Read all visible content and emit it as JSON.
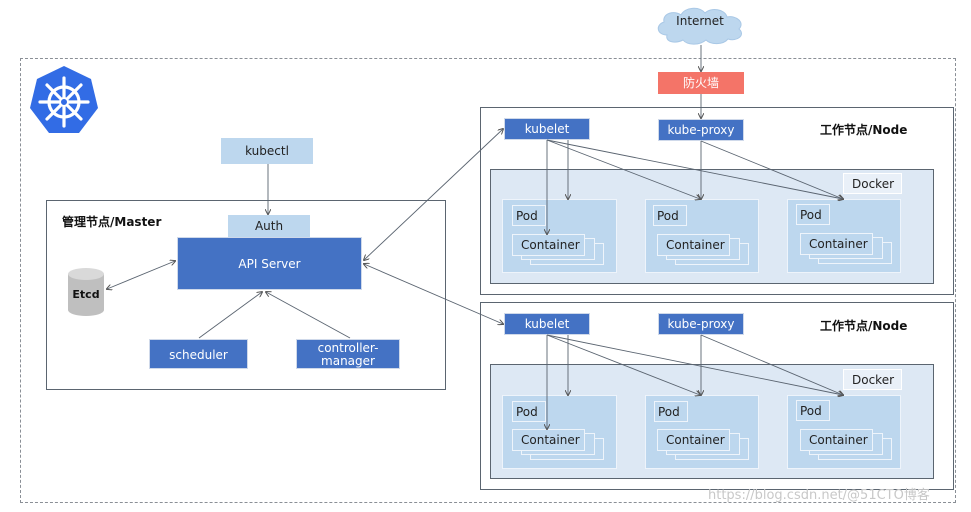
{
  "internet": {
    "label": "Internet"
  },
  "firewall": {
    "label": "防火墙"
  },
  "logo": {
    "icon": "kubernetes-helm-icon",
    "color": "#326ce5"
  },
  "master": {
    "title": "管理节点/Master",
    "kubectl": "kubectl",
    "auth": "Auth",
    "api_server": "API Server",
    "etcd": "Etcd",
    "scheduler": "scheduler",
    "controller_manager_line1": "controller-",
    "controller_manager_line2": "manager"
  },
  "nodes": [
    {
      "title": "工作节点/Node",
      "kubelet": "kubelet",
      "kube_proxy": "kube-proxy",
      "docker": "Docker",
      "pods": [
        {
          "pod": "Pod",
          "container": "Container"
        },
        {
          "pod": "Pod",
          "container": "Container"
        },
        {
          "pod": "Pod",
          "container": "Container"
        }
      ]
    },
    {
      "title": "工作节点/Node",
      "kubelet": "kubelet",
      "kube_proxy": "kube-proxy",
      "docker": "Docker",
      "pods": [
        {
          "pod": "Pod",
          "container": "Container"
        },
        {
          "pod": "Pod",
          "container": "Container"
        },
        {
          "pod": "Pod",
          "container": "Container"
        }
      ]
    }
  ],
  "colors": {
    "component_blue": "#4472c4",
    "light_blue": "#bdd7ee",
    "firewall_red": "#f47468",
    "docker_bg": "#dde8f4",
    "cloud": "#bdd7ee"
  },
  "watermark": "https://blog.csdn.net/@51CTO博客"
}
